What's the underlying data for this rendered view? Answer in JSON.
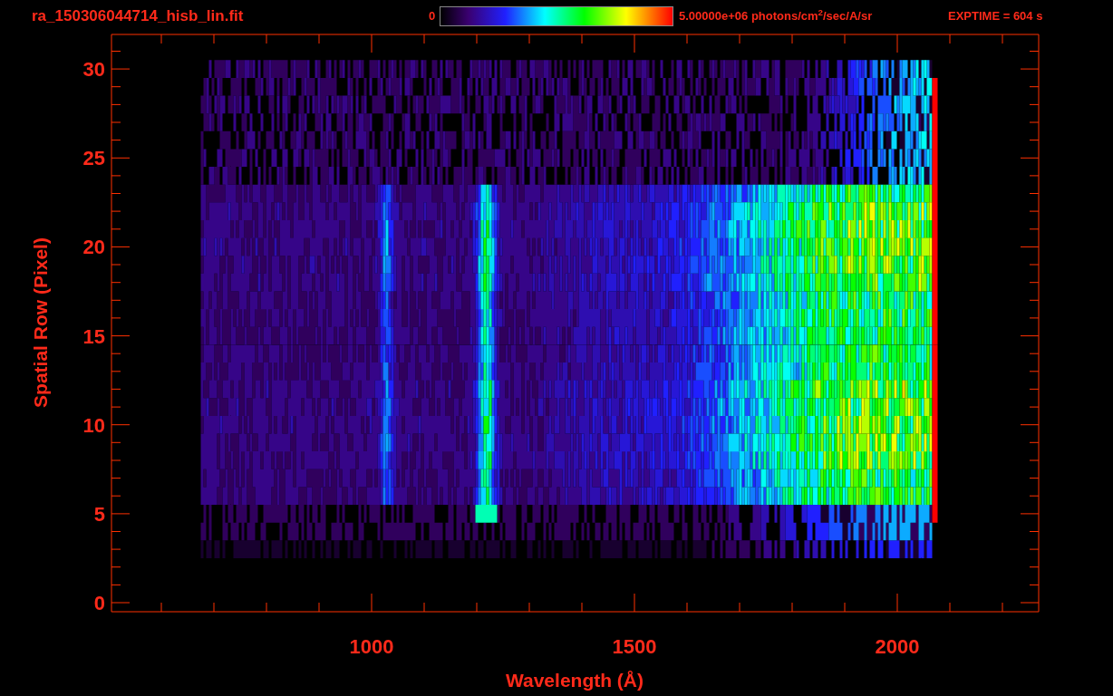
{
  "header": {
    "file_name": "ra_150306044714_hisb_lin.fit",
    "colorbar": {
      "min_label": "0",
      "max_label": "5.00000e+06 photons/cm$^{2}$/sec/A/sr"
    },
    "exposure": "EXPTIME = 604 s"
  },
  "plot": {
    "xlabel": "Wavelength (Å)",
    "ylabel": "Spatial Row (Pixel)",
    "xticks": [
      "1000",
      "1500",
      "2000"
    ],
    "yticks": [
      "30",
      "25",
      "20",
      "15",
      "10",
      "5",
      "0"
    ]
  }
}
